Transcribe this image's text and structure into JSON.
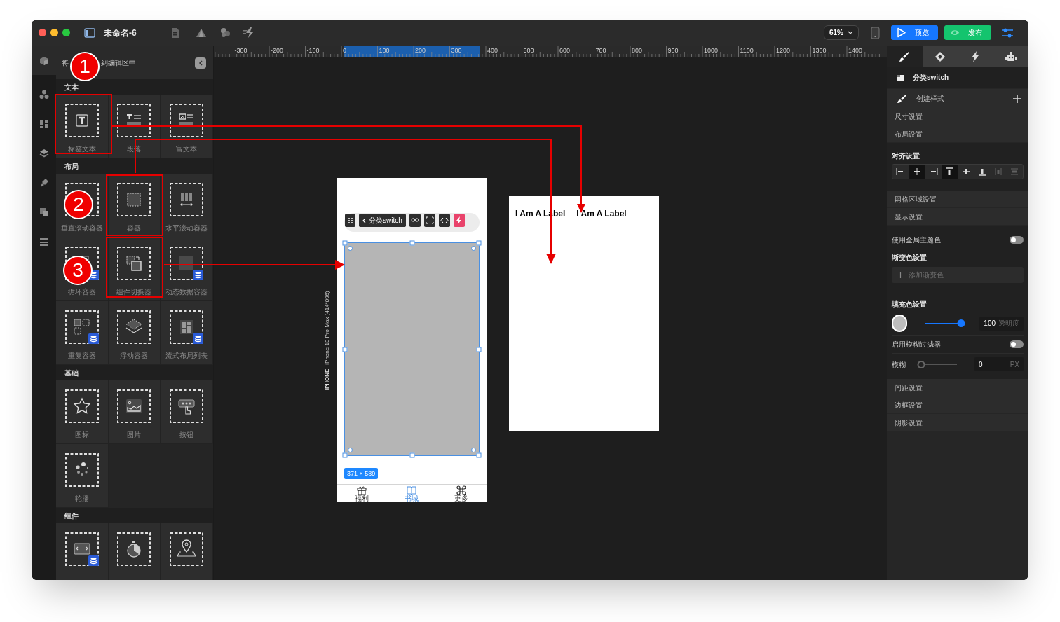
{
  "window": {
    "title": "未命名-6"
  },
  "toolbar": {
    "zoom": "61%",
    "buttons": [
      {
        "label": "预览",
        "kind": "preview"
      },
      {
        "label": "发布",
        "kind": "publish"
      }
    ]
  },
  "palette": {
    "header": [
      "将",
      "到编辑区中"
    ],
    "sections": [
      {
        "title": "文本",
        "items": [
          {
            "label": "标签文本",
            "kind": "text",
            "data_bound": false
          },
          {
            "label": "段落",
            "kind": "paragraph",
            "data_bound": false
          },
          {
            "label": "富文本",
            "kind": "richtext",
            "data_bound": false
          }
        ]
      },
      {
        "title": "布局",
        "items": [
          {
            "label": "垂直滚动容器",
            "kind": "vscroll",
            "data_bound": false
          },
          {
            "label": "容器",
            "kind": "container",
            "data_bound": false
          },
          {
            "label": "水平滚动容器",
            "kind": "hscroll",
            "data_bound": false
          },
          {
            "label": "循环容器",
            "kind": "loop",
            "data_bound": true
          },
          {
            "label": "组件切换器",
            "kind": "switcher",
            "data_bound": false
          },
          {
            "label": "动态数据容器",
            "kind": "dynamic",
            "data_bound": true
          },
          {
            "label": "重复容器",
            "kind": "repeat",
            "data_bound": true
          },
          {
            "label": "浮动容器",
            "kind": "float",
            "data_bound": false
          },
          {
            "label": "流式布局列表",
            "kind": "flow",
            "data_bound": true
          }
        ]
      },
      {
        "title": "基础",
        "items": [
          {
            "label": "图标",
            "kind": "icon",
            "data_bound": false
          },
          {
            "label": "图片",
            "kind": "image",
            "data_bound": false
          },
          {
            "label": "按钮",
            "kind": "button",
            "data_bound": false
          },
          {
            "label": "轮播",
            "kind": "carousel",
            "data_bound": false
          }
        ]
      },
      {
        "title": "组件",
        "items": [
          {
            "kind": "slide",
            "data_bound": true
          },
          {
            "kind": "timer",
            "data_bound": false
          },
          {
            "kind": "map",
            "data_bound": false
          }
        ]
      }
    ]
  },
  "canvas": {
    "ruler": {
      "labels": [
        "-300",
        "-200",
        "-100",
        "0",
        "100",
        "200",
        "300",
        "400",
        "500",
        "600",
        "700",
        "800",
        "900",
        "1000",
        "1100",
        "1200",
        "1300",
        "1400"
      ]
    },
    "device": {
      "model": "iPhone 13 Pro Max (414*896)",
      "type": "IPHONE"
    },
    "phone": {
      "breadcrumb": "分类switch",
      "size_badge": "371 × 589",
      "tabs": [
        {
          "label": "福利",
          "kind": "gift",
          "selected": false
        },
        {
          "label": "书城",
          "kind": "book",
          "selected": true
        },
        {
          "label": "更多",
          "kind": "command",
          "selected": false
        }
      ]
    },
    "card": {
      "labels": [
        "I Am A Label",
        "I Am A Label"
      ]
    }
  },
  "inspector": {
    "tabs": [
      {
        "kind": "brush",
        "selected": true
      },
      {
        "kind": "diamond",
        "selected": false
      },
      {
        "kind": "bolt",
        "selected": false
      },
      {
        "kind": "robot",
        "selected": false
      }
    ],
    "component": "分类switch",
    "rows": [
      {
        "kind": "create",
        "label": "创建样式"
      },
      {
        "kind": "section",
        "label": "尺寸设置"
      },
      {
        "kind": "section",
        "label": "布局设置"
      },
      {
        "kind": "align",
        "label": "对齐设置",
        "buttons": [
          {
            "kind": "left",
            "selected": false,
            "disabled": false
          },
          {
            "kind": "hcenter",
            "selected": true,
            "disabled": false
          },
          {
            "kind": "right",
            "selected": false,
            "disabled": false
          },
          {
            "kind": "top",
            "selected": true,
            "disabled": false
          },
          {
            "kind": "vcenter",
            "selected": false,
            "disabled": false
          },
          {
            "kind": "bottom",
            "selected": false,
            "disabled": false
          },
          {
            "kind": "hdist",
            "selected": false,
            "disabled": true
          },
          {
            "kind": "vdist",
            "selected": false,
            "disabled": true
          }
        ]
      },
      {
        "kind": "section",
        "label": "网格区域设置"
      },
      {
        "kind": "section",
        "label": "显示设置"
      },
      {
        "kind": "toggle",
        "label": "使用全局主题色",
        "on": false
      },
      {
        "kind": "gradient",
        "label": "渐变色设置",
        "button": "添加渐变色"
      },
      {
        "kind": "fill",
        "label": "填充色设置",
        "level": 1,
        "value": "100",
        "unit": "透明度"
      },
      {
        "kind": "toggle",
        "label": "启用模糊过滤器",
        "on": false
      },
      {
        "kind": "slider",
        "label": "模糊",
        "level": 0,
        "value": "0",
        "unit": "PX"
      },
      {
        "kind": "section",
        "label": "间距设置"
      },
      {
        "kind": "section",
        "label": "边框设置"
      },
      {
        "kind": "section",
        "label": "阴影设置"
      }
    ]
  },
  "annotations": {
    "steps": [
      "1",
      "2",
      "3"
    ]
  }
}
